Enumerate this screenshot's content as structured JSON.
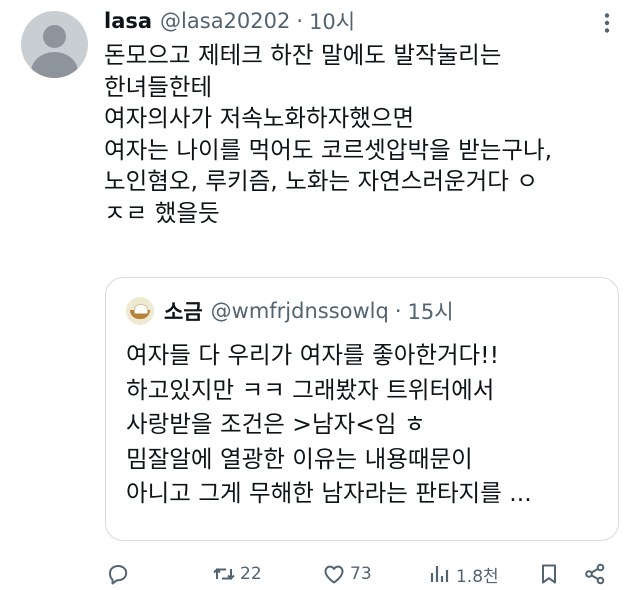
{
  "tweet": {
    "author_name": "lasa",
    "handle": "@lasa20202",
    "separator": "·",
    "time": "10시",
    "lines": [
      "돈모으고 제테크 하잔 말에도 발작눌리는",
      "한녀들한테",
      "여자의사가 저속노화하자했으면",
      "여자는 나이를 먹어도 코르셋압박을 받는구나,",
      "노인혐오, 루키즘, 노화는 자연스러운거다 ㅇ",
      "ㅈㄹ 했을듯"
    ]
  },
  "quoted": {
    "author_name": "소금",
    "handle": "@wmfrjdnssowlq",
    "separator": "·",
    "time": "15시",
    "lines": [
      "여자들 다 우리가 여자를 좋아한거다!!",
      "하고있지만 ㅋㅋ 그래봤자 트위터에서",
      "사랑받을 조건은 >남자<임 ㅎ",
      "밈잘알에 열광한 이유는 내용때문이",
      "아니고 그게 무해한 남자라는 판타지를 ..."
    ]
  },
  "actions": {
    "retweets": "22",
    "likes": "73",
    "views": "1.8천"
  }
}
